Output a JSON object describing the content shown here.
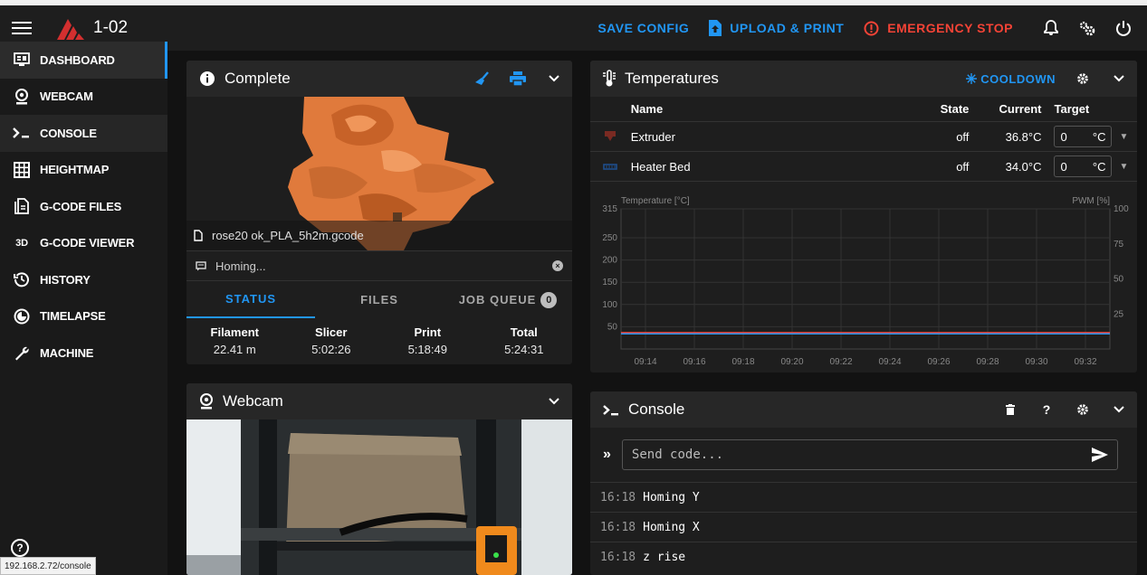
{
  "app": {
    "printer_name": "1-02",
    "status_url": "192.168.2.72/console"
  },
  "topbar": {
    "save_config": "SAVE CONFIG",
    "upload_print": "UPLOAD & PRINT",
    "emergency_stop": "EMERGENCY STOP"
  },
  "sidebar": {
    "items": [
      {
        "label": "DASHBOARD",
        "icon": "monitor-dashboard-icon"
      },
      {
        "label": "WEBCAM",
        "icon": "webcam-icon"
      },
      {
        "label": "CONSOLE",
        "icon": "console-icon"
      },
      {
        "label": "HEIGHTMAP",
        "icon": "grid-icon"
      },
      {
        "label": "G-CODE FILES",
        "icon": "file-document-icon"
      },
      {
        "label": "G-CODE VIEWER",
        "icon": "3d-icon"
      },
      {
        "label": "HISTORY",
        "icon": "history-icon"
      },
      {
        "label": "TIMELAPSE",
        "icon": "timelapse-icon"
      },
      {
        "label": "MACHINE",
        "icon": "wrench-icon"
      }
    ],
    "viewer_icon_text": "3D",
    "help": "?"
  },
  "status_panel": {
    "title": "Complete",
    "filename": "rose20 ok_PLA_5h2m.gcode",
    "message": "Homing...",
    "tabs": {
      "status": "STATUS",
      "files": "FILES",
      "job_queue": "JOB QUEUE",
      "job_queue_count": "0"
    },
    "stats": [
      {
        "label": "Filament",
        "value": "22.41 m"
      },
      {
        "label": "Slicer",
        "value": "5:02:26"
      },
      {
        "label": "Print",
        "value": "5:18:49"
      },
      {
        "label": "Total",
        "value": "5:24:31"
      }
    ]
  },
  "webcam_panel": {
    "title": "Webcam"
  },
  "temps_panel": {
    "title": "Temperatures",
    "cooldown": "COOLDOWN",
    "headers": {
      "name": "Name",
      "state": "State",
      "current": "Current",
      "target": "Target"
    },
    "rows": [
      {
        "name": "Extruder",
        "state": "off",
        "current": "36.8°C",
        "target": "0",
        "unit": "°C",
        "icon": "extruder-icon",
        "color": "#f44336"
      },
      {
        "name": "Heater Bed",
        "state": "off",
        "current": "34.0°C",
        "target": "0",
        "unit": "°C",
        "icon": "heater-bed-icon",
        "color": "#2196f3"
      }
    ]
  },
  "chart_data": {
    "type": "line",
    "ylabel": "Temperature [°C]",
    "y2label": "PWM [%]",
    "yticks": [
      "315",
      "250",
      "200",
      "150",
      "100",
      "50"
    ],
    "y2ticks": [
      "100",
      "75",
      "50",
      "25"
    ],
    "x": [
      "09:14",
      "09:16",
      "09:18",
      "09:20",
      "09:22",
      "09:24",
      "09:26",
      "09:28",
      "09:30",
      "09:32"
    ],
    "ylim": [
      0,
      315
    ],
    "y2lim": [
      0,
      100
    ],
    "series": [
      {
        "name": "Extruder",
        "color": "#f44336",
        "values": [
          36.8,
          36.8,
          36.8,
          36.8,
          36.8,
          36.8,
          36.8,
          36.8,
          36.8,
          36.8
        ]
      },
      {
        "name": "Heater Bed",
        "color": "#2196f3",
        "values": [
          34.0,
          34.0,
          34.0,
          34.0,
          34.0,
          34.0,
          34.0,
          34.0,
          34.0,
          34.0
        ]
      }
    ],
    "grid": true
  },
  "console_panel": {
    "title": "Console",
    "placeholder": "Send code...",
    "lines": [
      {
        "time": "16:18",
        "text": "Homing Y"
      },
      {
        "time": "16:18",
        "text": "Homing X"
      },
      {
        "time": "16:18",
        "text": "z rise"
      }
    ]
  }
}
